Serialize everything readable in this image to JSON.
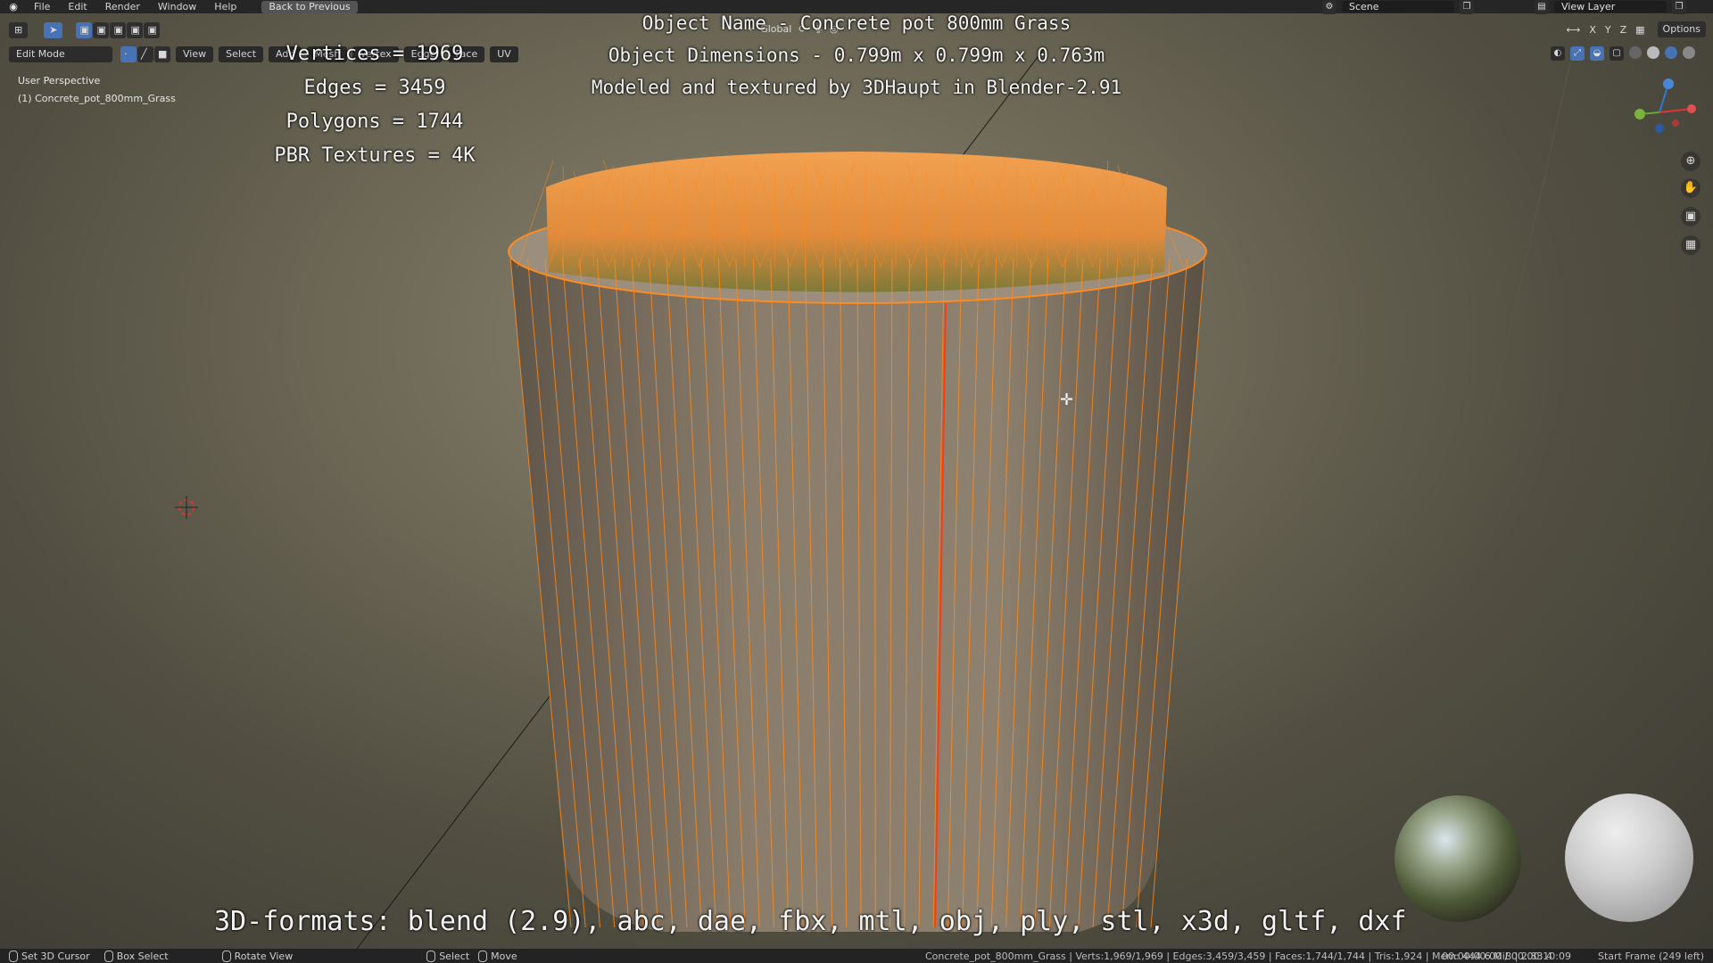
{
  "topbar": {
    "menu": [
      "File",
      "Edit",
      "Render",
      "Window",
      "Help"
    ],
    "back_button": "Back to Previous",
    "scene": "Scene",
    "view_layer": "View Layer"
  },
  "header": {
    "mode": "Edit Mode",
    "menus": [
      "View",
      "Select",
      "Add",
      "Mesh",
      "Vertex",
      "Edge",
      "Face",
      "UV"
    ],
    "transform_orientation": "Global",
    "axes": [
      "X",
      "Y",
      "Z"
    ],
    "options": "Options"
  },
  "viewport": {
    "perspective": "User Perspective",
    "object_label": "(1) Concrete_pot_800mm_Grass"
  },
  "overlay": {
    "vertices": "Vertices = 1969",
    "edges": "Edges = 3459",
    "polygons": "Polygons = 1744",
    "pbr": "PBR Textures = 4K",
    "object_name": "Object Name - Concrete pot 800mm Grass",
    "dimensions": "Object Dimensions -  0.799m x 0.799m x 0.763m",
    "credit": "Modeled and textured by 3DHaupt in Blender-2.91",
    "formats": "3D-formats: blend (2.9), abc, dae, fbx, mtl, obj, ply, stl, x3d, gltf, dxf"
  },
  "statusbar": {
    "set_cursor": "Set 3D Cursor",
    "box_select": "Box Select",
    "rotate_view": "Rotate View",
    "select": "Select",
    "move": "Move",
    "stats": "Concrete_pot_800mm_Grass | Verts:1,969/1,969 | Edges:3,459/3,459 | Faces:1,744/1,744 | Tris:1,924 | Mem: 444.6 MiB | 2.83.4",
    "time": "00:00:00:00 / 00:00:10:09",
    "start_frame": "Start Frame (249 left)"
  },
  "colors": {
    "accent": "#4772b3",
    "wire": "#ff8a1e",
    "concrete": "#7a6a58"
  }
}
